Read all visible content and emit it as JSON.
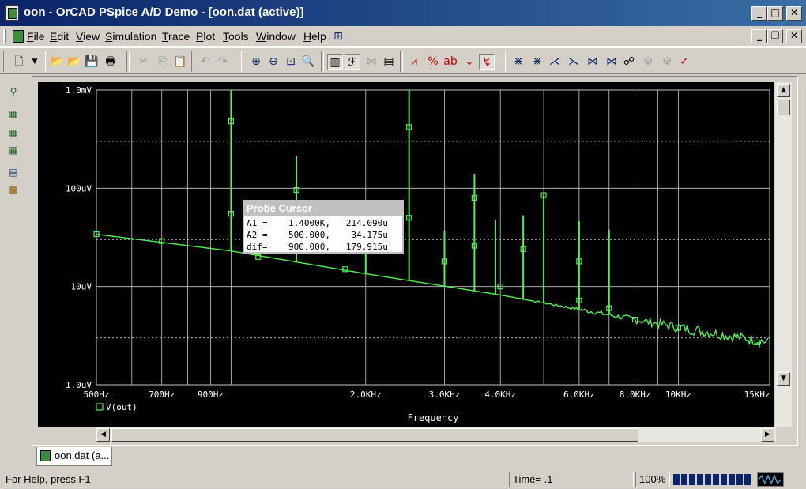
{
  "window": {
    "title": "oon - OrCAD PSpice A/D Demo  - [oon.dat (active)]"
  },
  "menu": {
    "items": [
      {
        "label": "File",
        "u": "F",
        "rest": "ile"
      },
      {
        "label": "Edit",
        "u": "E",
        "rest": "dit"
      },
      {
        "label": "View",
        "u": "V",
        "rest": "iew"
      },
      {
        "label": "Simulation",
        "u": "S",
        "rest": "imulation"
      },
      {
        "label": "Trace",
        "u": "T",
        "rest": "race"
      },
      {
        "label": "Plot",
        "u": "P",
        "rest": "lot"
      },
      {
        "label": "Tools",
        "u": "T",
        "rest": "ools"
      },
      {
        "label": "Window",
        "u": "W",
        "rest": "indow"
      },
      {
        "label": "Help",
        "u": "H",
        "rest": "elp"
      }
    ]
  },
  "toolbar": {
    "icons": [
      "new-icon",
      "open-icon",
      "open-all-icon",
      "save-icon",
      "print-icon",
      "cut-icon",
      "copy-icon",
      "paste-icon",
      "undo-icon",
      "redo-icon",
      "zoom-in-icon",
      "zoom-out-icon",
      "zoom-area-icon",
      "zoom-fit-icon",
      "log-x-icon",
      "fourier-icon",
      "performance-icon",
      "add-trace-icon",
      "add-plot-icon",
      "eval-measure-icon",
      "mark-label-icon",
      "toggle-cursor-icon",
      "cursor-peak-icon",
      "cursor-trough-icon",
      "cursor-slope-icon",
      "cursor-min-icon",
      "cursor-max-icon",
      "cursor-point-icon",
      "cursor-search-icon",
      "cursor-next-transition-icon",
      "cursor-prev-transition-icon",
      "mark-data-points-icon"
    ]
  },
  "left_toolbar": {
    "icons": [
      "probe-icon",
      "simulation-settings-icon",
      "view-output-icon",
      "run-icon",
      "netlist-icon",
      "message-icon"
    ]
  },
  "chart_data": {
    "type": "line",
    "title": "",
    "xlabel": "Frequency",
    "ylabel": "",
    "x_scale": "log",
    "y_scale": "log",
    "xlim": [
      500,
      16000
    ],
    "ylim": [
      1e-06,
      0.001
    ],
    "x_ticks": [
      {
        "value": 500,
        "label": "500Hz"
      },
      {
        "value": 700,
        "label": "700Hz"
      },
      {
        "value": 900,
        "label": "900Hz"
      },
      {
        "value": 2000,
        "label": "2.0KHz"
      },
      {
        "value": 3000,
        "label": "3.0KHz"
      },
      {
        "value": 4000,
        "label": "4.0KHz"
      },
      {
        "value": 6000,
        "label": "6.0KHz"
      },
      {
        "value": 8000,
        "label": "8.0KHz"
      },
      {
        "value": 10000,
        "label": "10KHz"
      },
      {
        "value": 15000,
        "label": "15KHz"
      }
    ],
    "y_ticks": [
      {
        "value": 0.001,
        "label": "1.0mV"
      },
      {
        "value": 0.0001,
        "label": "100uV"
      },
      {
        "value": 1e-05,
        "label": "10uV"
      },
      {
        "value": 1e-06,
        "label": "1.0uV"
      }
    ],
    "grid": true,
    "legend": {
      "position": "bottom-left",
      "entries": [
        "V(out)"
      ]
    },
    "series": [
      {
        "name": "V(out)",
        "color": "#55ee55",
        "baseline": [
          [
            500,
            3.4e-05
          ],
          [
            1000,
            2.3e-05
          ],
          [
            2000,
            1.35e-05
          ],
          [
            4000,
            8.2e-06
          ],
          [
            8000,
            4.6e-06
          ],
          [
            16000,
            2.7e-06
          ]
        ],
        "peaks": [
          [
            1000,
            0.001
          ],
          [
            1400,
            0.000214
          ],
          [
            2000,
            7.2e-05
          ],
          [
            2500,
            0.001
          ],
          [
            3000,
            3.7e-05
          ],
          [
            3500,
            0.00014
          ],
          [
            3900,
            4.8e-05
          ],
          [
            4500,
            5.3e-05
          ],
          [
            5000,
            8.6e-05
          ],
          [
            6000,
            4.6e-05
          ],
          [
            7000,
            3.8e-05
          ]
        ],
        "markers": [
          [
            500,
            3.4e-05
          ],
          [
            1000,
            0.00048
          ],
          [
            1000,
            5.5e-05
          ],
          [
            700,
            2.9e-05
          ],
          [
            1150,
            2e-05
          ],
          [
            1400,
            9.6e-05
          ],
          [
            1400,
            3.4e-05
          ],
          [
            1800,
            1.5e-05
          ],
          [
            2000,
            2.5e-05
          ],
          [
            2500,
            5e-05
          ],
          [
            2500,
            0.00042
          ],
          [
            3000,
            1.8e-05
          ],
          [
            3500,
            2.6e-05
          ],
          [
            3500,
            8e-05
          ],
          [
            4000,
            1e-05
          ],
          [
            4500,
            2.4e-05
          ],
          [
            5000,
            8.5e-05
          ],
          [
            6000,
            1.8e-05
          ],
          [
            6000,
            7.2e-06
          ],
          [
            7000,
            6e-06
          ],
          [
            8000,
            4.6e-06
          ],
          [
            10000,
            3.8e-06
          ],
          [
            15000,
            2.7e-06
          ]
        ]
      }
    ]
  },
  "probe_cursor": {
    "title": "Probe Cursor",
    "rows": [
      {
        "label": "A1 =",
        "x": "1.4000K,",
        "y": "214.090u"
      },
      {
        "label": "A2 =",
        "x": "500.000,",
        "y": "34.175u"
      },
      {
        "label": "dif=",
        "x": "900.000,",
        "y": "179.915u"
      }
    ]
  },
  "doc_tab": {
    "label": "oon.dat (a..."
  },
  "status": {
    "help": "For Help, press F1",
    "time": "Time= .1",
    "progress_pct": "100%",
    "progress_fraction": 1.0
  },
  "colors": {
    "trace": "#55ee55",
    "plot_bg": "#000000",
    "grid": "#c8c8c8",
    "axis_text": "#ffffff",
    "titlebar": "#0a246a"
  }
}
